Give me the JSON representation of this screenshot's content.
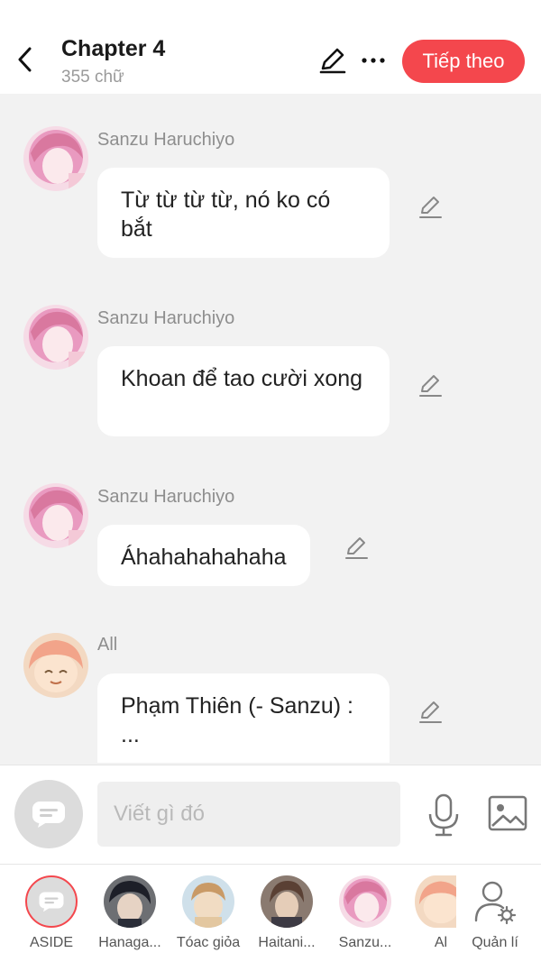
{
  "header": {
    "title": "Chapter 4",
    "subtitle": "355 chữ",
    "next_label": "Tiếp theo"
  },
  "messages": [
    {
      "sender": "Sanzu Haruchiyo",
      "text": "Từ từ từ từ, nó ko có bắt",
      "avatar": "pink-hair-avatar"
    },
    {
      "sender": "Sanzu Haruchiyo",
      "text": "Khoan để tao cười xong",
      "avatar": "pink-hair-avatar"
    },
    {
      "sender": "Sanzu Haruchiyo",
      "text": "Áhahahahahaha",
      "avatar": "pink-hair-avatar"
    },
    {
      "sender": "All",
      "text": "Phạm Thiên (- Sanzu) : ...",
      "avatar": "anya-avatar"
    }
  ],
  "composer": {
    "placeholder": "Viết gì đó"
  },
  "characters": [
    {
      "label": "ASIDE",
      "icon": "aside-chat-icon",
      "selected": true
    },
    {
      "label": "Hanaga...",
      "icon": "dark-hair-avatar"
    },
    {
      "label": "Tóac giỏa",
      "icon": "author-avatar"
    },
    {
      "label": "Haitani...",
      "icon": "brown-hair-avatar"
    },
    {
      "label": "Sanzu...",
      "icon": "pink-hair-avatar"
    },
    {
      "label": "Al",
      "icon": "anya-avatar"
    },
    {
      "label": "Quản lí",
      "icon": "user-settings-icon"
    }
  ],
  "colors": {
    "accent": "#f4474d",
    "background": "#f2f2f2",
    "bubble": "#ffffff",
    "muted_text": "#8e8e8e"
  }
}
